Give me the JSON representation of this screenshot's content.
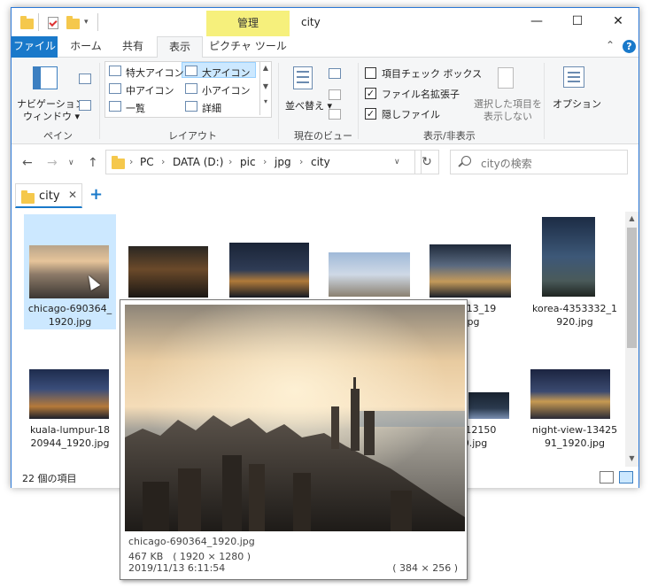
{
  "titlebar": {
    "contextual_tab": "管理",
    "title": "city",
    "minimize": "—",
    "maximize": "☐",
    "close": "✕"
  },
  "ribbon_tabs": {
    "file": "ファイル",
    "home": "ホーム",
    "share": "共有",
    "view": "表示",
    "picture_tools": "ピクチャ ツール",
    "collapse": "⌃",
    "help": "?"
  },
  "ribbon": {
    "pane_group": {
      "nav_pane_line1": "ナビゲーション",
      "nav_pane_line2": "ウィンドウ",
      "label": "ペイン"
    },
    "layout_group": {
      "items": [
        "特大アイコン",
        "大アイコン",
        "中アイコン",
        "小アイコン",
        "一覧",
        "詳細"
      ],
      "selected": "大アイコン",
      "label": "レイアウト"
    },
    "current_view_group": {
      "sort_by": "並べ替え",
      "label": "現在のビュー"
    },
    "show_hide_group": {
      "item_checkboxes": "項目チェック ボックス",
      "file_extensions": "ファイル名拡張子",
      "hidden_items": "隠しファイル",
      "item_checkboxes_checked": false,
      "file_extensions_checked": true,
      "hidden_items_checked": true,
      "hide_selected_line1": "選択した項目を",
      "hide_selected_line2": "表示しない",
      "label": "表示/非表示"
    },
    "options": "オプション"
  },
  "navigation": {
    "back": "←",
    "forward": "→",
    "dropdown": "∨",
    "up": "↑",
    "breadcrumb": [
      "PC",
      "DATA (D:)",
      "pic",
      "jpg",
      "city"
    ],
    "addr_dropdown": "∨",
    "refresh": "↻",
    "search_placeholder": "cityの検索"
  },
  "tabs": {
    "current": "city",
    "close": "✕",
    "new": "+"
  },
  "files": [
    {
      "line1": "chicago-690364_",
      "line2": "1920.jpg"
    },
    {
      "line1": "",
      "line2": ""
    },
    {
      "line1": "",
      "line2": ""
    },
    {
      "line1": "",
      "line2": ""
    },
    {
      "line1": "81813_19",
      "line2": "jpg"
    },
    {
      "line1": "korea-4353332_1",
      "line2": "920.jpg"
    },
    {
      "line1": "kuala-lumpur-18",
      "line2": "20944_1920.jpg"
    },
    {
      "line1": "ew-12150",
      "line2": "20.jpg"
    },
    {
      "line1": "night-view-13425",
      "line2": "91_1920.jpg"
    }
  ],
  "status": {
    "count": "22 個の項目"
  },
  "preview": {
    "filename": "chicago-690364_1920.jpg",
    "size": "467 KB　( 1920 × 1280 )",
    "date": "2019/11/13 6:11:54",
    "preview_dims": "( 384 × 256 )"
  },
  "colors": {
    "accent": "#1979ca",
    "selection": "#cce8ff",
    "manage_tab": "#f6f07c",
    "folder": "#f5c84c"
  }
}
